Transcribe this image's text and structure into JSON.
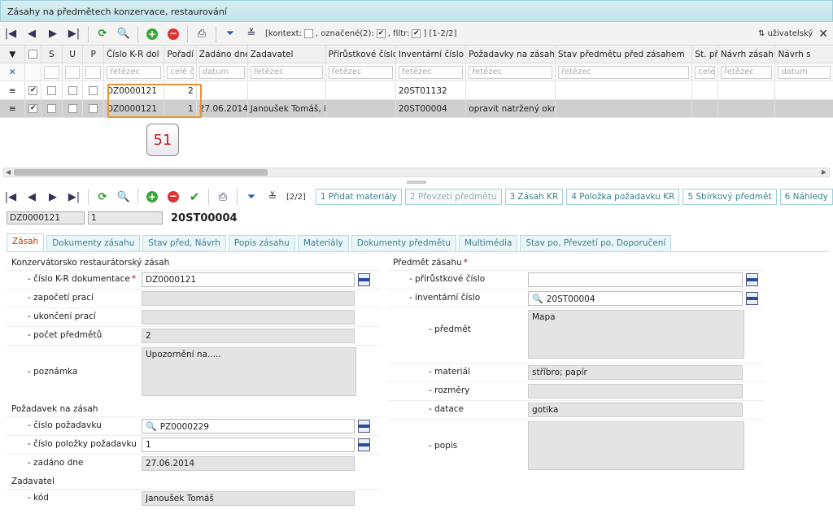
{
  "window": {
    "title": "Zásahy na předmětech konzervace, restaurování"
  },
  "top_toolbar": {
    "context_label": "[kontext:",
    "marked_label": ", označené(2):",
    "filter_label": ", filtr:",
    "range_label": "] [1-2/2]",
    "user_label": "uživatelský"
  },
  "grid": {
    "columns": [
      "S",
      "U",
      "P",
      "Číslo K-R dol",
      "Pořadí",
      "Zadáno dne",
      "Zadavatel",
      "Přírůstkové číslo",
      "Inventární číslo",
      "Požadavky na zásah",
      "Stav předmětu před zásahem",
      "St. př",
      "Návrh zásahu",
      "Návrh s"
    ],
    "filters": [
      "řetězec",
      "celé čí",
      "datum",
      "řetězec",
      "řetězec",
      "řetězec",
      "řetězec",
      "řetězec",
      "celé",
      "řetězec",
      "datum"
    ],
    "rows": [
      {
        "doc": "DZ0000121",
        "order": "2",
        "date": "",
        "requester": "",
        "accession": "",
        "inventory": "20ST01132",
        "requests": ""
      },
      {
        "doc": "DZ0000121",
        "order": "1",
        "date": "27.06.2014",
        "requester": "Janoušek Tomáš, i",
        "accession": "",
        "inventory": "20ST00004",
        "requests": "opravit natržený okraj"
      }
    ],
    "badge": "51"
  },
  "bottom_toolbar": {
    "counter": "[2/2]",
    "tab_buttons": [
      "1 Přidat materiály",
      "2 Převzetí předmětu",
      "3 Zásah KR",
      "4 Položka požadavku KR",
      "5 Sbírkový předmět",
      "6 Náhledy"
    ]
  },
  "record": {
    "doc": "DZ0000121",
    "order": "1",
    "title": "20ST00004"
  },
  "tabs": [
    "Zásah",
    "Dokumenty zásahu",
    "Stav před, Návrh",
    "Popis zásahu",
    "Materiály",
    "Dokumenty předmětu",
    "Multimédia",
    "Stav po, Převzetí po, Doporučení"
  ],
  "left_form": {
    "sec1": "Konzervátorsko restaurátorský zásah",
    "doc_label": "- číslo K-R dokumentace",
    "doc_value": "DZ0000121",
    "start_label": "- započetí prací",
    "end_label": "- ukončení prací",
    "count_label": "- počet předmětů",
    "count_value": "2",
    "note_label": "- poznámka",
    "note_value": "Upozornění na.....",
    "sec2": "Požadavek na zásah",
    "req_label": "- číslo požadavku",
    "req_value": "PZ0000229",
    "item_label": "- číslo položky požadavku",
    "item_value": "1",
    "date_label": "- zadáno dne",
    "date_value": "27.06.2014",
    "sec3": "Zadavatel",
    "code_label": "- kód",
    "code_value": "Janoušek Tomáš"
  },
  "right_form": {
    "sec": "Předmět zásahu",
    "acc_label": "- přírůstkové číslo",
    "inv_label": "- inventární číslo",
    "inv_value": "20ST00004",
    "obj_label": "- předmět",
    "obj_value": "Mapa",
    "mat_label": "- materiál",
    "mat_value": "stříbro; papír",
    "dim_label": "- rozměry",
    "dat_label": "- datace",
    "dat_value": "gotika",
    "desc_label": "- popis"
  }
}
